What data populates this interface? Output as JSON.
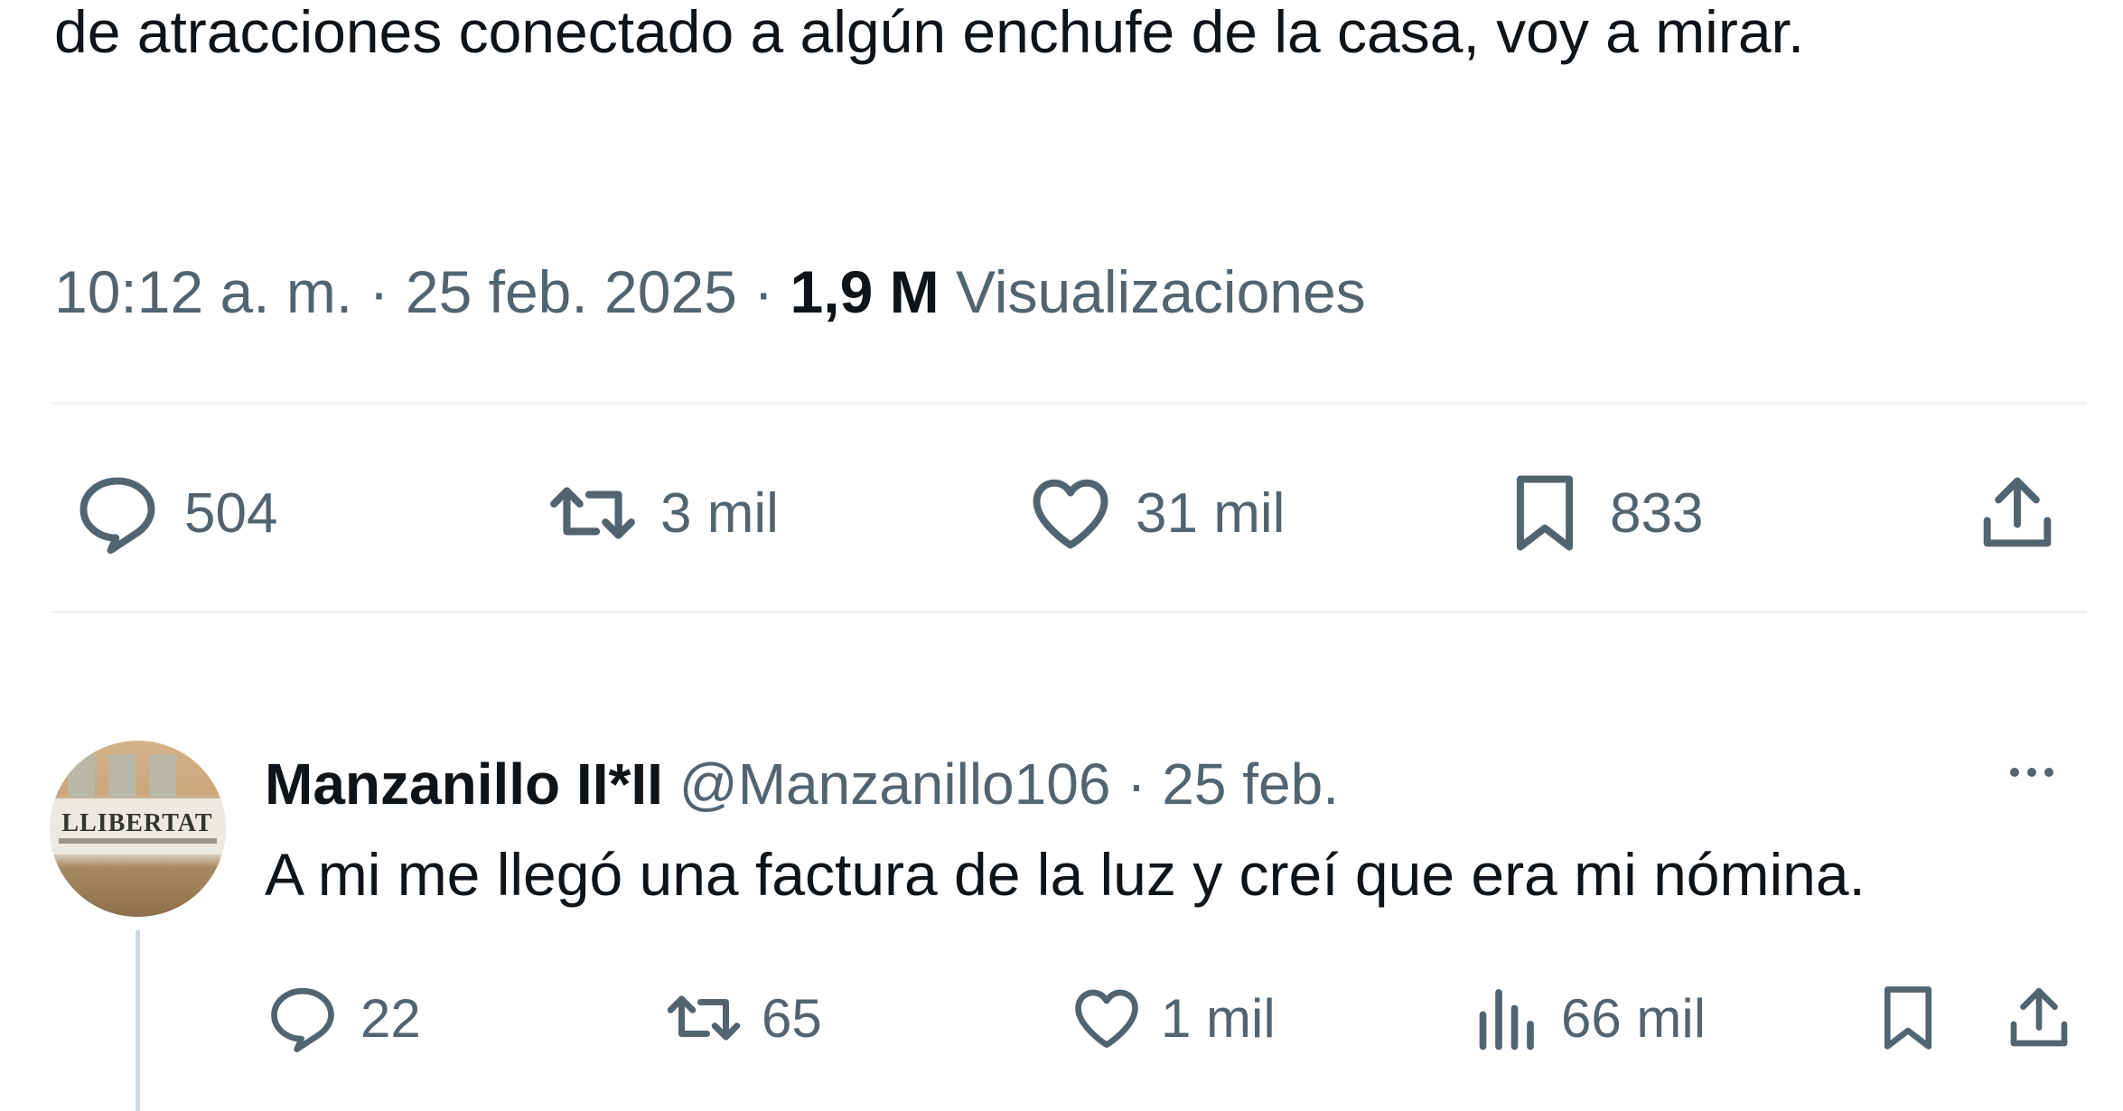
{
  "tweet": {
    "text": "de atracciones conectado a algún enchufe de la casa, voy a mirar.",
    "time": "10:12 a. m.",
    "separator": "·",
    "date": "25 feb. 2025",
    "views_count": "1,9 M",
    "views_label": "Visualizaciones",
    "actions": {
      "replies": "504",
      "reposts": "3 mil",
      "likes": "31 mil",
      "bookmarks": "833"
    }
  },
  "reply": {
    "name": "Manzanillo II*II",
    "handle": "@Manzanillo106",
    "separator": "·",
    "date": "25 feb.",
    "text": "A mi me llegó una factura de la luz y creí que era mi nómina.",
    "avatar_text": "LLIBERTAT",
    "actions": {
      "replies": "22",
      "reposts": "65",
      "likes": "1 mil",
      "views": "66 mil"
    }
  },
  "colors": {
    "text_primary": "#0f1419",
    "text_secondary": "#536471",
    "divider": "#eff3f4",
    "thread_line": "#cfd9de"
  }
}
